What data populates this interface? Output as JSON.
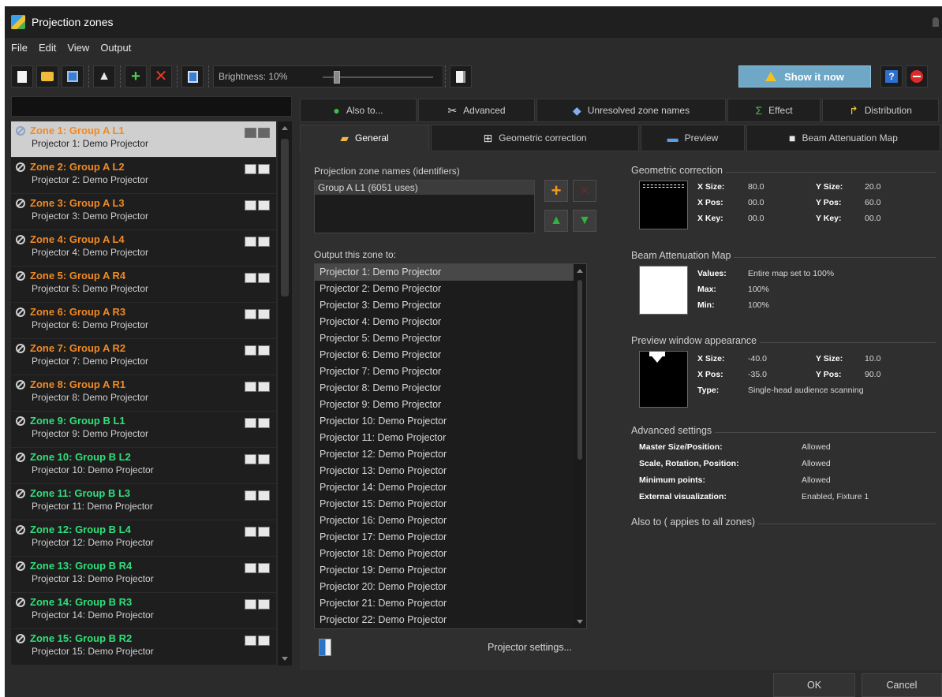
{
  "window": {
    "title": "Projection zones"
  },
  "menu": [
    "File",
    "Edit",
    "View",
    "Output"
  ],
  "toolbar": {
    "brightness_label": "Brightness: 10%",
    "brightness_value": 10,
    "show_now_label": "Show it now",
    "help_label": "?"
  },
  "zones": [
    {
      "name": "Zone 1: Group A L1",
      "projector": "Projector 1: Demo Projector",
      "color": "#f08a24",
      "selected": true
    },
    {
      "name": "Zone 2: Group A L2",
      "projector": "Projector 2: Demo Projector",
      "color": "#f08a24"
    },
    {
      "name": "Zone 3: Group A L3",
      "projector": "Projector 3: Demo Projector",
      "color": "#f08a24"
    },
    {
      "name": "Zone 4: Group A L4",
      "projector": "Projector 4: Demo Projector",
      "color": "#f08a24"
    },
    {
      "name": "Zone 5: Group A R4",
      "projector": "Projector 5: Demo Projector",
      "color": "#f08a24"
    },
    {
      "name": "Zone 6: Group A R3",
      "projector": "Projector 6: Demo Projector",
      "color": "#f08a24"
    },
    {
      "name": "Zone 7: Group A R2",
      "projector": "Projector 7: Demo Projector",
      "color": "#f08a24"
    },
    {
      "name": "Zone 8: Group A R1",
      "projector": "Projector 8: Demo Projector",
      "color": "#f08a24"
    },
    {
      "name": "Zone 9: Group B L1",
      "projector": "Projector 9: Demo Projector",
      "color": "#2fe07a"
    },
    {
      "name": "Zone 10: Group B L2",
      "projector": "Projector 10: Demo Projector",
      "color": "#2fe07a"
    },
    {
      "name": "Zone 11: Group B L3",
      "projector": "Projector 11: Demo Projector",
      "color": "#2fe07a"
    },
    {
      "name": "Zone 12: Group B L4",
      "projector": "Projector 12: Demo Projector",
      "color": "#2fe07a"
    },
    {
      "name": "Zone 13: Group B R4",
      "projector": "Projector 13: Demo Projector",
      "color": "#2fe07a"
    },
    {
      "name": "Zone 14: Group B R3",
      "projector": "Projector 14: Demo Projector",
      "color": "#2fe07a"
    },
    {
      "name": "Zone 15: Group B R2",
      "projector": "Projector 15: Demo Projector",
      "color": "#2fe07a"
    }
  ],
  "tabs_row1": [
    {
      "label": "Also to...",
      "icon": "plus-circle-icon"
    },
    {
      "label": "Advanced",
      "icon": "tools-icon"
    },
    {
      "label": "Unresolved zone names",
      "icon": "diamond-icon"
    },
    {
      "label": "Effect",
      "icon": "sigma-icon"
    },
    {
      "label": "Distribution",
      "icon": "split-arrow-icon"
    }
  ],
  "tabs_row2": [
    {
      "label": "General",
      "icon": "projector-icon",
      "active": true
    },
    {
      "label": "Geometric correction",
      "icon": "grid-icon"
    },
    {
      "label": "Preview",
      "icon": "monitor-icon"
    },
    {
      "label": "Beam Attenuation Map",
      "icon": "bam-icon"
    }
  ],
  "general": {
    "names_title": "Projection zone names (identifiers)",
    "names": [
      "Group A L1 (6051 uses)"
    ],
    "output_title": "Output this zone to:",
    "outputs": [
      "Projector 1: Demo Projector",
      "Projector 2: Demo Projector",
      "Projector 3: Demo Projector",
      "Projector 4: Demo Projector",
      "Projector 5: Demo Projector",
      "Projector 6: Demo Projector",
      "Projector 7: Demo Projector",
      "Projector 8: Demo Projector",
      "Projector 9: Demo Projector",
      "Projector 10: Demo Projector",
      "Projector 11: Demo Projector",
      "Projector 12: Demo Projector",
      "Projector 13: Demo Projector",
      "Projector 14: Demo Projector",
      "Projector 15: Demo Projector",
      "Projector 16: Demo Projector",
      "Projector 17: Demo Projector",
      "Projector 18: Demo Projector",
      "Projector 19: Demo Projector",
      "Projector 20: Demo Projector",
      "Projector 21: Demo Projector",
      "Projector 22: Demo Projector"
    ],
    "projector_settings_label": "Projector settings..."
  },
  "geometric": {
    "title": "Geometric correction",
    "x_size_label": "X Size:",
    "x_size": "80.0",
    "y_size_label": "Y Size:",
    "y_size": "20.0",
    "x_pos_label": "X Pos:",
    "x_pos": "00.0",
    "y_pos_label": "Y Pos:",
    "y_pos": "60.0",
    "x_key_label": "X Key:",
    "x_key": "00.0",
    "y_key_label": "Y Key:",
    "y_key": "00.0"
  },
  "bam": {
    "title": "Beam Attenuation Map",
    "values_label": "Values:",
    "values": "Entire map set to 100%",
    "max_label": "Max:",
    "max": "100%",
    "min_label": "Min:",
    "min": "100%"
  },
  "preview": {
    "title": "Preview window appearance",
    "x_size_label": "X Size:",
    "x_size": "-40.0",
    "y_size_label": "Y Size:",
    "y_size": "10.0",
    "x_pos_label": "X Pos:",
    "x_pos": "-35.0",
    "y_pos_label": "Y Pos:",
    "y_pos": "90.0",
    "type_label": "Type:",
    "type": "Single-head audience scanning"
  },
  "advanced": {
    "title": "Advanced settings",
    "rows": [
      {
        "label": "Master Size/Position:",
        "value": "Allowed"
      },
      {
        "label": "Scale, Rotation, Position:",
        "value": "Allowed"
      },
      {
        "label": "Minimum points:",
        "value": "Allowed"
      },
      {
        "label": "External visualization:",
        "value": "Enabled, Fixture 1"
      }
    ]
  },
  "also_to": {
    "title": "Also to ( appies to all zones)"
  },
  "footer": {
    "ok_label": "OK",
    "cancel_label": "Cancel"
  }
}
